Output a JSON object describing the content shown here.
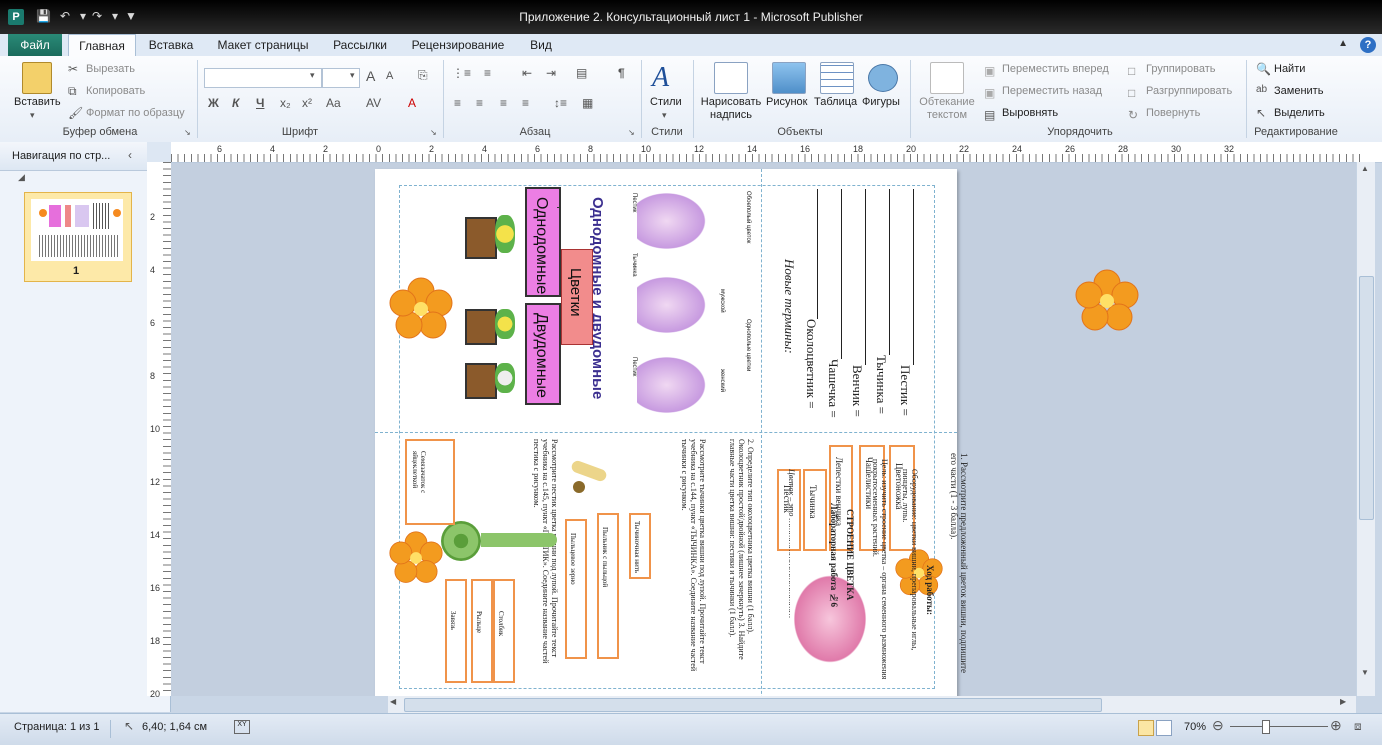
{
  "window": {
    "title": "Приложение 2. Консультационный лист 1  -  Microsoft Publisher",
    "app_icon_letter": "P"
  },
  "tabs": [
    "Файл",
    "Главная",
    "Вставка",
    "Макет страницы",
    "Рассылки",
    "Рецензирование",
    "Вид"
  ],
  "ribbon": {
    "clipboard": {
      "paste": "Вставить",
      "cut": "Вырезать",
      "copy": "Копировать",
      "format_painter": "Формат по образцу",
      "label": "Буфер обмена"
    },
    "font": {
      "label": "Шрифт",
      "bold": "Ж",
      "italic": "К",
      "underline": "Ч",
      "size_up": "A",
      "aa": "Aa"
    },
    "paragraph": {
      "label": "Абзац"
    },
    "styles": {
      "button": "Стили",
      "label": "Стили"
    },
    "objects": {
      "draw_text": "Нарисовать надпись",
      "picture": "Рисунок",
      "table": "Таблица",
      "shapes": "Фигуры",
      "label": "Объекты"
    },
    "arrange": {
      "wrap_text": "Обтекание текстом",
      "bring_forward": "Переместить вперед",
      "send_backward": "Переместить назад",
      "align": "Выровнять",
      "group": "Группировать",
      "ungroup": "Разгруппировать",
      "rotate": "Повернуть",
      "label": "Упорядочить"
    },
    "editing": {
      "find": "Найти",
      "replace": "Заменить",
      "select": "Выделить",
      "label": "Редактирование"
    }
  },
  "nav_pane": {
    "title": "Навигация по стр...",
    "page_number": "1"
  },
  "ruler": {
    "h_ticks": [
      "6",
      "4",
      "2",
      "0",
      "2",
      "4",
      "6",
      "8",
      "10",
      "12",
      "14",
      "16",
      "18",
      "20",
      "22",
      "24",
      "26",
      "28",
      "30",
      "32"
    ],
    "v_ticks": [
      "2",
      "4",
      "6",
      "8",
      "10",
      "12",
      "14",
      "16",
      "18",
      "20"
    ]
  },
  "document": {
    "heading": "Однодомные и двудомные",
    "box_mono": "Однодомные",
    "box_flowers": "Цветки",
    "box_dio": "Двудомные",
    "flower_small_labels": [
      "Обоеполый цветок",
      "Однополые цветки",
      "мужской",
      "женский",
      "Пестик",
      "Тычинка",
      "Пестик"
    ],
    "new_terms_title": "Новые термины:",
    "terms": [
      "Околоцветник =",
      "Чашечка =",
      "Венчик =",
      "Тычинка =",
      "Пестик ="
    ],
    "lab_title": "Лабораторная работа №6",
    "lab_subtitle": "СТРОЕНИЕ ЦВЕТКА",
    "goal": "Цель: изучить строение цветка – органа семенного размножения покрытосеменных растений.",
    "equipment": "Оборудование: цветки вишни, препаровальные иглы, пинцеты, лупы.",
    "progress": "Ход работы:",
    "step1": "1. Рассмотрите предложенный цветок вишни, подпишите его части (1 - 3 балла).",
    "flower_parts": [
      "Пестик",
      "Тычинка",
      "Лепестки венчика",
      "Чашелистики",
      "Цветоножка"
    ],
    "flower_def": "Цветок – это ……………………………………",
    "step2": "2. Определите тип околоцветника цветка вишни (1 балл). Околоцветник простой/двойной (лишнее зачеркнуть)",
    "step3": "3. Найдите главные части цветка вишни: пестики и тычинки (1 балл).",
    "stamen_text": "Рассмотрите тычинки цветка вишни под лупой. Прочитайте текст учебника на с.144, пункт «ТЫЧИНКА». Соедините название частей тычинки с рисунком.",
    "pistil_text": "Рассмотрите пестик цветка вишни под лупой. Прочитайте текст учебника на с.145, пункт «ПЕСТИК». Соедините название частей пестика с рисунком.",
    "stamen_parts": [
      "Тычиночная нить",
      "Пыльник с пыльцой",
      "Пыльцевое зерно"
    ],
    "pistil_parts": [
      "Столбик",
      "Рыльце",
      "Завязь"
    ],
    "seed_label": "Семязачаток с яйцеклеткой"
  },
  "status": {
    "page": "Страница: 1 из 1",
    "position": "6,40; 1,64 см",
    "zoom": "70%"
  }
}
